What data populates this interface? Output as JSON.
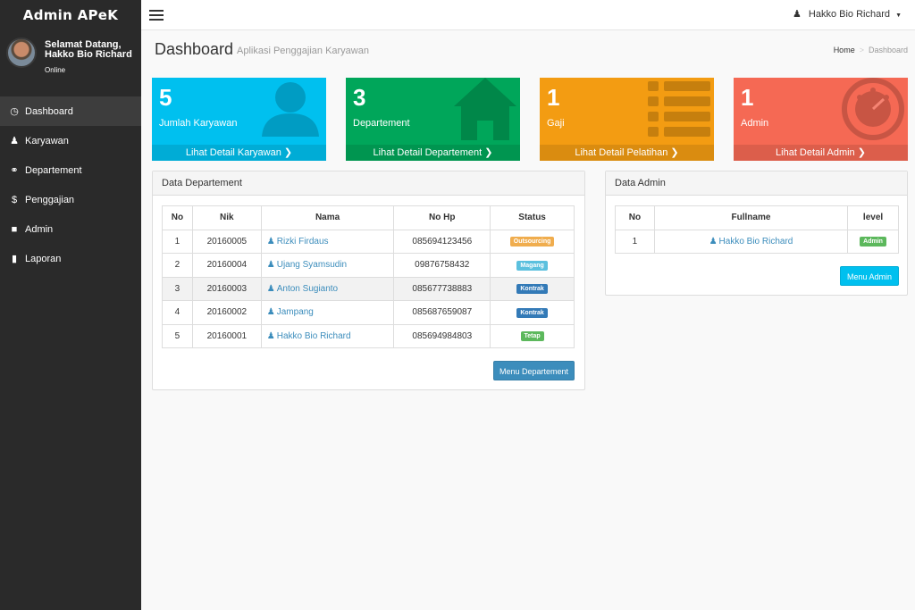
{
  "sidebar": {
    "brand": "Admin APeK",
    "welcome_line1": "Selamat Datang,",
    "welcome_line2": "Hakko Bio Richard",
    "status": "Online",
    "items": [
      {
        "label": "Dashboard",
        "icon": "dashboard-icon",
        "active": true
      },
      {
        "label": "Karyawan",
        "icon": "user-icon"
      },
      {
        "label": "Departement",
        "icon": "link-icon"
      },
      {
        "label": "Penggajian",
        "icon": "dollar-icon"
      },
      {
        "label": "Admin",
        "icon": "lock-icon"
      },
      {
        "label": "Laporan",
        "icon": "file-icon"
      }
    ]
  },
  "topbar": {
    "user_name": "Hakko Bio Richard"
  },
  "header": {
    "title": "Dashboard",
    "subtitle": "Aplikasi Penggajian Karyawan",
    "breadcrumb_home": "Home",
    "breadcrumb_current": "Dashboard"
  },
  "boxes": [
    {
      "number": "5",
      "label": "Jumlah Karyawan",
      "link": "Lihat Detail Karyawan",
      "color": "#00c0ef",
      "icon": "user-icon"
    },
    {
      "number": "3",
      "label": "Departement",
      "link": "Lihat Detail Departement",
      "color": "#00a65a",
      "icon": "home-icon"
    },
    {
      "number": "1",
      "label": "Gaji",
      "link": "Lihat Detail Pelatihan",
      "color": "#f39c12",
      "icon": "list-icon"
    },
    {
      "number": "1",
      "label": "Admin",
      "link": "Lihat Detail Admin",
      "color": "#f56954",
      "icon": "dashboard-icon"
    }
  ],
  "departement_panel": {
    "title": "Data Departement",
    "columns": [
      "No",
      "Nik",
      "Nama",
      "No Hp",
      "Status"
    ],
    "rows": [
      {
        "no": "1",
        "nik": "20160005",
        "nama": "Rizki Firdaus",
        "hp": "085694123456",
        "status": "Outsourcing",
        "status_color": "#f0ad4e"
      },
      {
        "no": "2",
        "nik": "20160004",
        "nama": "Ujang Syamsudin",
        "hp": "09876758432",
        "status": "Magang",
        "status_color": "#5bc0de"
      },
      {
        "no": "3",
        "nik": "20160003",
        "nama": "Anton Sugianto",
        "hp": "085677738883",
        "status": "Kontrak",
        "status_color": "#337ab7"
      },
      {
        "no": "4",
        "nik": "20160002",
        "nama": "Jampang",
        "hp": "085687659087",
        "status": "Kontrak",
        "status_color": "#337ab7"
      },
      {
        "no": "5",
        "nik": "20160001",
        "nama": "Hakko Bio Richard",
        "hp": "085694984803",
        "status": "Tetap",
        "status_color": "#5cb85c"
      }
    ],
    "button": "Menu Departement"
  },
  "admin_panel": {
    "title": "Data Admin",
    "columns": [
      "No",
      "Fullname",
      "level"
    ],
    "rows": [
      {
        "no": "1",
        "fullname": "Hakko Bio Richard",
        "level": "Admin",
        "level_color": "#5cb85c"
      }
    ],
    "button": "Menu Admin"
  }
}
